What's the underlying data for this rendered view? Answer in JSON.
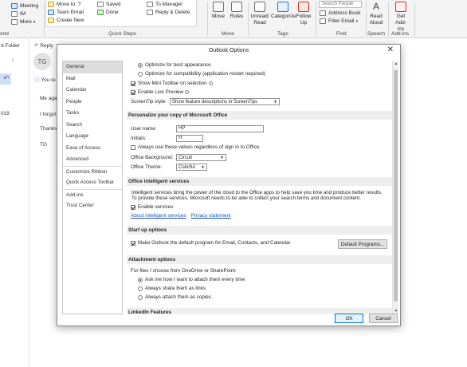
{
  "ribbon": {
    "left_label": "ond",
    "meeting": "Meeting",
    "im": "IM",
    "more": "More",
    "quick_steps": {
      "move_to": "Move to: ?",
      "team_email": "Team Email",
      "create_new": "Create New",
      "saved": "Saved",
      "done": "Done",
      "to_manager": "To Manager",
      "reply_delete": "Reply & Delete",
      "group_label": "Quick Steps"
    },
    "move": {
      "move": "Move",
      "rules": "Rules",
      "group_label": "Move"
    },
    "tags": {
      "unread_read": "Unread/ Read",
      "categorize": "Categorize",
      "follow_up": "Follow Up",
      "group_label": "Tags"
    },
    "find": {
      "search_people": "Search People",
      "address_book": "Address Book",
      "filter_email": "Filter Email",
      "group_label": "Find"
    },
    "speech": {
      "read_aloud": "Read Aloud",
      "group_label": "Speech"
    },
    "addins": {
      "get_addins": "Get Add-ins",
      "group_label": "Add-ins"
    }
  },
  "background": {
    "folder_label": "d Folder",
    "reply": "Reply",
    "you_re": "You re",
    "year": "019",
    "avatar": "TG",
    "lines": [
      "Me aga",
      "I forgot",
      "Thanks",
      "TG"
    ]
  },
  "dialog": {
    "title": "Outlook Options",
    "nav": [
      "General",
      "Mail",
      "Calendar",
      "People",
      "Tasks",
      "Search",
      "Language",
      "Ease of Access",
      "Advanced",
      "Customize Ribbon",
      "Quick Access Toolbar",
      "Add-ins",
      "Trust Center"
    ],
    "general": {
      "optimize_appearance": "Optimize for best appearance",
      "optimize_compat": "Optimize for compatibility (application restart required)",
      "show_mini_toolbar": "Show Mini Toolbar on selection",
      "enable_live_preview": "Enable Live Preview",
      "screentip_label": "ScreenTip style:",
      "screentip_value": "Show feature descriptions in ScreenTips",
      "personalize_header": "Personalize your copy of Microsoft Office",
      "username_label": "User name:",
      "username_value": "HP",
      "initials_label": "Initials:",
      "initials_value": "H",
      "always_use": "Always use these values regardless of sign in to Office.",
      "background_label": "Office Background:",
      "background_value": "Circuit",
      "theme_label": "Office Theme:",
      "theme_value": "Colorful",
      "intelligent_header": "Office intelligent services",
      "intelligent_text_1": "Intelligent services bring the power of the cloud to the Office apps to help save you time and produce better results.",
      "intelligent_text_2": "To provide these services, Microsoft needs to be able to collect your search terms and document content.",
      "enable_services": "Enable services",
      "about_services": "About intelligent services",
      "privacy": "Privacy statement",
      "startup_header": "Start up options",
      "make_default": "Make Outlook the default program for Email, Contacts, and Calendar",
      "default_programs": "Default Programs...",
      "attachment_header": "Attachment options",
      "files_label": "For files I choose from OneDrive or SharePoint:",
      "ask_me": "Ask me how I want to attach them every time",
      "always_links": "Always share them as links",
      "always_copies": "Always attach them as copies",
      "linkedin_header": "LinkedIn Features"
    },
    "ok": "OK",
    "cancel": "Cancel"
  }
}
